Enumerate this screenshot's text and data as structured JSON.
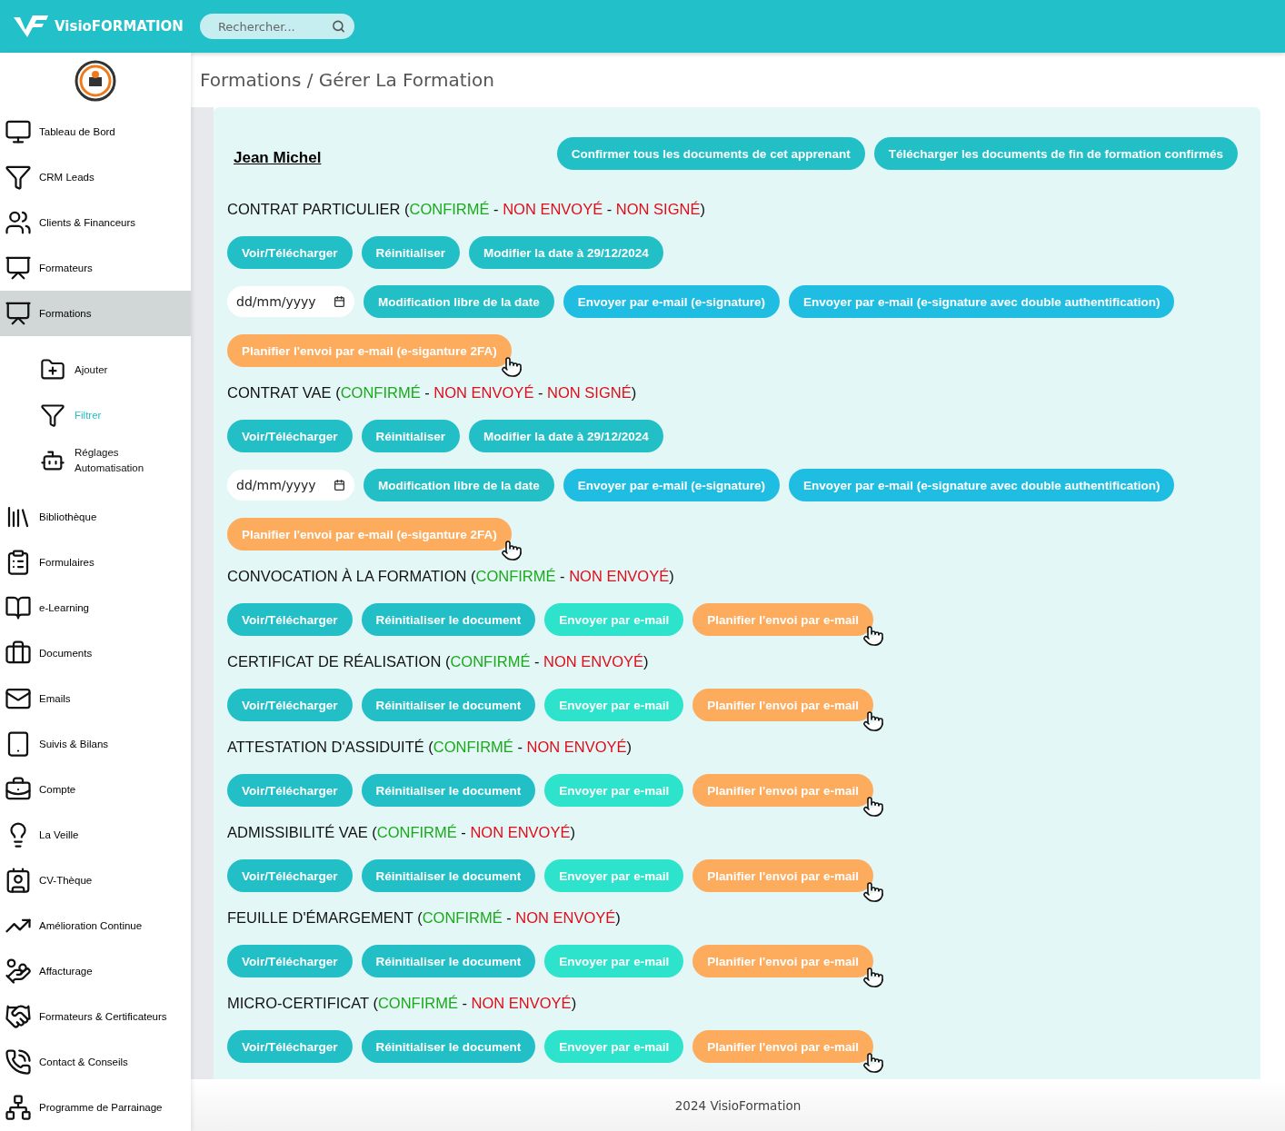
{
  "header": {
    "brand": "VisioFORMATION",
    "search": {
      "placeholder": "Rechercher..."
    }
  },
  "sidebar": {
    "items": [
      {
        "label": "Tableau de Bord",
        "selected": false
      },
      {
        "label": "CRM Leads",
        "selected": false
      },
      {
        "label": "Clients & Financeurs",
        "selected": false
      },
      {
        "label": "Formateurs",
        "selected": false
      },
      {
        "label": "Formations",
        "selected": true,
        "children": [
          {
            "label": "Ajouter",
            "selected": false
          },
          {
            "label": "Filtrer",
            "selected": true
          },
          {
            "label": "Réglages Automatisation",
            "selected": false
          }
        ]
      },
      {
        "label": "Bibliothèque",
        "selected": false
      },
      {
        "label": "Formulaires",
        "selected": false
      },
      {
        "label": "e-Learning",
        "selected": false
      },
      {
        "label": "Documents",
        "selected": false
      },
      {
        "label": "Emails",
        "selected": false
      },
      {
        "label": "Suivis & Bilans",
        "selected": false
      },
      {
        "label": "Compte",
        "selected": false
      },
      {
        "label": "La Veille",
        "selected": false
      },
      {
        "label": "CV-Thèque",
        "selected": false
      },
      {
        "label": "Amélioration Continue",
        "selected": false
      },
      {
        "label": "Affacturage",
        "selected": false
      },
      {
        "label": "Formateurs & Certificateurs",
        "selected": false
      },
      {
        "label": "Contact & Conseils",
        "selected": false
      },
      {
        "label": "Programme de Parrainage",
        "selected": false
      }
    ]
  },
  "breadcrumb": "Formations / Gérer La Formation",
  "learner": {
    "name": "Jean Michel",
    "actions": [
      "Confirmer tous les documents de cet apprenant",
      "Télécharger les documents de fin de formation confirmés"
    ]
  },
  "sections": [
    {
      "heading": [
        {
          "text": "CONTRAT PARTICULIER (",
          "kind": "plain"
        },
        {
          "text": "CONFIRMÉ",
          "kind": "confirmed"
        },
        {
          "text": " - ",
          "kind": "plain"
        },
        {
          "text": "NON ENVOYÉ",
          "kind": "missing"
        },
        {
          "text": " - ",
          "kind": "plain"
        },
        {
          "text": "NON SIGNÉ",
          "kind": "missing"
        },
        {
          "text": ")",
          "kind": "plain"
        }
      ],
      "rows": [
        [
          {
            "kind": "primary",
            "label": "Voir/Télécharger"
          },
          {
            "kind": "primary",
            "label": "Réinitialiser"
          },
          {
            "kind": "primary",
            "label": "Modifier la date à 29/12/2024"
          }
        ],
        [
          {
            "kind": "date",
            "placeholder": "dd/mm/yyyy"
          },
          {
            "kind": "primary",
            "label": "Modification libre de la date"
          },
          {
            "kind": "email",
            "label": "Envoyer par e-mail (e-signature)"
          },
          {
            "kind": "email",
            "label": "Envoyer par e-mail (e-signature avec double authentification)"
          }
        ],
        [
          {
            "kind": "schedule",
            "label": "Planifier l'envoi par e-mail (e-siganture 2FA)"
          }
        ]
      ]
    },
    {
      "heading": [
        {
          "text": "CONTRAT VAE (",
          "kind": "plain"
        },
        {
          "text": "CONFIRMÉ",
          "kind": "confirmed"
        },
        {
          "text": " - ",
          "kind": "plain"
        },
        {
          "text": "NON ENVOYÉ",
          "kind": "missing"
        },
        {
          "text": " - ",
          "kind": "plain"
        },
        {
          "text": "NON SIGNÉ",
          "kind": "missing"
        },
        {
          "text": ")",
          "kind": "plain"
        }
      ],
      "rows": [
        [
          {
            "kind": "primary",
            "label": "Voir/Télécharger"
          },
          {
            "kind": "primary",
            "label": "Réinitialiser"
          },
          {
            "kind": "primary",
            "label": "Modifier la date à 29/12/2024"
          }
        ],
        [
          {
            "kind": "date",
            "placeholder": "dd/mm/yyyy"
          },
          {
            "kind": "primary",
            "label": "Modification libre de la date"
          },
          {
            "kind": "email",
            "label": "Envoyer par e-mail (e-signature)"
          },
          {
            "kind": "email",
            "label": "Envoyer par e-mail (e-signature avec double authentification)"
          }
        ],
        [
          {
            "kind": "schedule",
            "label": "Planifier l'envoi par e-mail (e-siganture 2FA)"
          }
        ]
      ]
    },
    {
      "heading": [
        {
          "text": "CONVOCATION À LA FORMATION (",
          "kind": "plain"
        },
        {
          "text": "CONFIRMÉ",
          "kind": "confirmed"
        },
        {
          "text": " - ",
          "kind": "plain"
        },
        {
          "text": "NON ENVOYÉ",
          "kind": "missing"
        },
        {
          "text": ")",
          "kind": "plain"
        }
      ],
      "rows": [
        [
          {
            "kind": "primary",
            "label": "Voir/Télécharger"
          },
          {
            "kind": "primary",
            "label": "Réinitialiser le document"
          },
          {
            "kind": "send",
            "label": "Envoyer par e-mail"
          },
          {
            "kind": "schedule",
            "label": "Planifier l'envoi par e-mail"
          }
        ]
      ]
    },
    {
      "heading": [
        {
          "text": "CERTIFICAT DE RÉALISATION (",
          "kind": "plain"
        },
        {
          "text": "CONFIRMÉ",
          "kind": "confirmed"
        },
        {
          "text": " - ",
          "kind": "plain"
        },
        {
          "text": "NON ENVOYÉ",
          "kind": "missing"
        },
        {
          "text": ")",
          "kind": "plain"
        }
      ],
      "rows": [
        [
          {
            "kind": "primary",
            "label": "Voir/Télécharger"
          },
          {
            "kind": "primary",
            "label": "Réinitialiser le document"
          },
          {
            "kind": "send",
            "label": "Envoyer par e-mail"
          },
          {
            "kind": "schedule",
            "label": "Planifier l'envoi par e-mail"
          }
        ]
      ]
    },
    {
      "heading": [
        {
          "text": "ATTESTATION D'ASSIDUITÉ (",
          "kind": "plain"
        },
        {
          "text": "CONFIRMÉ",
          "kind": "confirmed"
        },
        {
          "text": " - ",
          "kind": "plain"
        },
        {
          "text": "NON ENVOYÉ",
          "kind": "missing"
        },
        {
          "text": ")",
          "kind": "plain"
        }
      ],
      "rows": [
        [
          {
            "kind": "primary",
            "label": "Voir/Télécharger"
          },
          {
            "kind": "primary",
            "label": "Réinitialiser le document"
          },
          {
            "kind": "send",
            "label": "Envoyer par e-mail"
          },
          {
            "kind": "schedule",
            "label": "Planifier l'envoi par e-mail"
          }
        ]
      ]
    },
    {
      "heading": [
        {
          "text": "ADMISSIBILITÉ VAE (",
          "kind": "plain"
        },
        {
          "text": "CONFIRMÉ",
          "kind": "confirmed"
        },
        {
          "text": " - ",
          "kind": "plain"
        },
        {
          "text": "NON ENVOYÉ",
          "kind": "missing"
        },
        {
          "text": ")",
          "kind": "plain"
        }
      ],
      "rows": [
        [
          {
            "kind": "primary",
            "label": "Voir/Télécharger"
          },
          {
            "kind": "primary",
            "label": "Réinitialiser le document"
          },
          {
            "kind": "send",
            "label": "Envoyer par e-mail"
          },
          {
            "kind": "schedule",
            "label": "Planifier l'envoi par e-mail"
          }
        ]
      ]
    },
    {
      "heading": [
        {
          "text": "FEUILLE D'ÉMARGEMENT (",
          "kind": "plain"
        },
        {
          "text": "CONFIRMÉ",
          "kind": "confirmed"
        },
        {
          "text": " - ",
          "kind": "plain"
        },
        {
          "text": "NON ENVOYÉ",
          "kind": "missing"
        },
        {
          "text": ")",
          "kind": "plain"
        }
      ],
      "rows": [
        [
          {
            "kind": "primary",
            "label": "Voir/Télécharger"
          },
          {
            "kind": "primary",
            "label": "Réinitialiser le document"
          },
          {
            "kind": "send",
            "label": "Envoyer par e-mail"
          },
          {
            "kind": "schedule",
            "label": "Planifier l'envoi par e-mail"
          }
        ]
      ]
    },
    {
      "heading": [
        {
          "text": "MICRO-CERTIFICAT (",
          "kind": "plain"
        },
        {
          "text": "CONFIRMÉ",
          "kind": "confirmed"
        },
        {
          "text": " - ",
          "kind": "plain"
        },
        {
          "text": "NON ENVOYÉ",
          "kind": "missing"
        },
        {
          "text": ")",
          "kind": "plain"
        }
      ],
      "rows": [
        [
          {
            "kind": "primary",
            "label": "Voir/Télécharger"
          },
          {
            "kind": "primary",
            "label": "Réinitialiser le document"
          },
          {
            "kind": "send",
            "label": "Envoyer par e-mail"
          },
          {
            "kind": "schedule",
            "label": "Planifier l'envoi par e-mail"
          }
        ]
      ]
    }
  ],
  "footer": "2024 VisioFormation"
}
